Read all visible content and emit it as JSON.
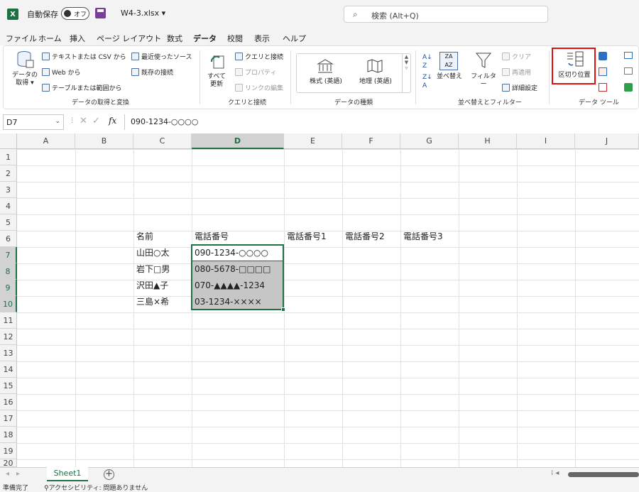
{
  "titlebar": {
    "autosave_label": "自動保存",
    "autosave_state": "オフ",
    "filename": "W4-3.xlsx",
    "search_placeholder": "検索 (Alt+Q)"
  },
  "menu_tabs": [
    "ファイル",
    "ホーム",
    "挿入",
    "ページ レイアウト",
    "数式",
    "データ",
    "校閲",
    "表示",
    "ヘルプ"
  ],
  "active_tab": "データ",
  "ribbon": {
    "get_data": {
      "big_label": "データの\n取得",
      "from_text_csv": "テキストまたは CSV から",
      "from_web": "Web から",
      "from_table": "テーブルまたは範囲から",
      "recent_sources": "最近使ったソース",
      "existing_connections": "既存の接続",
      "group_label": "データの取得と変換"
    },
    "queries": {
      "refresh_all": "すべて\n更新",
      "queries_connections": "クエリと接続",
      "properties": "プロパティ",
      "edit_links": "リンクの編集",
      "group_label": "クエリと接続"
    },
    "data_types": {
      "stocks": "株式 (英語)",
      "geography": "地理 (英語)",
      "group_label": "データの種類"
    },
    "sort_filter": {
      "sort": "並べ替え",
      "filter": "フィルター",
      "clear": "クリア",
      "reapply": "再適用",
      "advanced": "詳細設定",
      "group_label": "並べ替えとフィルター"
    },
    "data_tools": {
      "text_to_columns": "区切り位置",
      "group_label": "データ ツール"
    }
  },
  "formula_bar": {
    "name_box": "D7",
    "formula": "090-1234-○○○○"
  },
  "columns": [
    "A",
    "B",
    "C",
    "D",
    "E",
    "F",
    "G",
    "H",
    "I",
    "J"
  ],
  "selected_column": "D",
  "rows": [
    "1",
    "2",
    "3",
    "4",
    "5",
    "6",
    "7",
    "8",
    "9",
    "10",
    "11",
    "12",
    "13",
    "14",
    "15",
    "16",
    "17",
    "18",
    "19",
    "20"
  ],
  "selected_rows": [
    "7",
    "8",
    "9",
    "10"
  ],
  "cells": {
    "C6": "名前",
    "D6": "電話番号",
    "E6": "電話番号1",
    "F6": "電話番号2",
    "G6": "電話番号3",
    "C7": "山田○太",
    "D7": "090-1234-○○○○",
    "C8": "岩下□男",
    "D8": "080-5678-□□□□",
    "C9": "沢田▲子",
    "D9": "070-▲▲▲▲-1234",
    "C10": "三島×希",
    "D10": "03-1234-××××"
  },
  "sheet_tab": "Sheet1",
  "status": {
    "ready": "準備完了",
    "accessibility": "アクセシビリティ: 問題ありません"
  },
  "colors": {
    "excel_green": "#1e7145",
    "highlight_red": "#e01010",
    "selection_gray": "#c6c6c6"
  }
}
